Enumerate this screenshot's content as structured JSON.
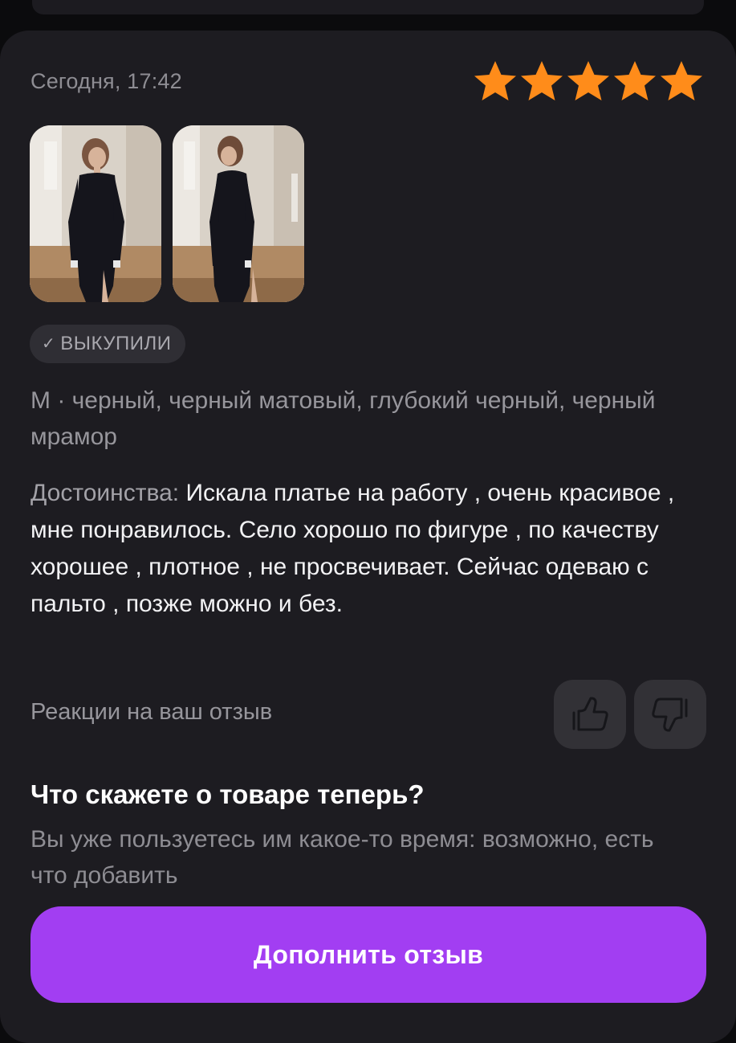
{
  "review": {
    "date": "Сегодня, 17:42",
    "rating": 5,
    "photos": [
      {
        "icon": "photo-dress-front"
      },
      {
        "icon": "photo-dress-back"
      }
    ],
    "badge": {
      "label": "ВЫКУПИЛИ",
      "icon": "check-icon",
      "check_glyph": "✓"
    },
    "variant": "М · черный, черный матовый, глубокий черный, черный мрамор",
    "pros_label": "Достоинства:",
    "pros_text": " Искала платье на работу , очень красивое , мне понравилось. Село хорошо по фигуре , по качеству хорошее , плотное , не просвечивает. Сейчас одеваю с пальто , позже можно и без."
  },
  "reactions": {
    "label": "Реакции на ваш отзыв"
  },
  "prompt": {
    "title": "Что скажете о товаре теперь?",
    "text": "Вы уже пользуетесь им какое-то время: возможно, есть что добавить"
  },
  "cta": {
    "label": "Дополнить отзыв"
  },
  "colors": {
    "star": "#ff8c1a",
    "accent": "#a23ef2",
    "card": "#1d1c21"
  }
}
